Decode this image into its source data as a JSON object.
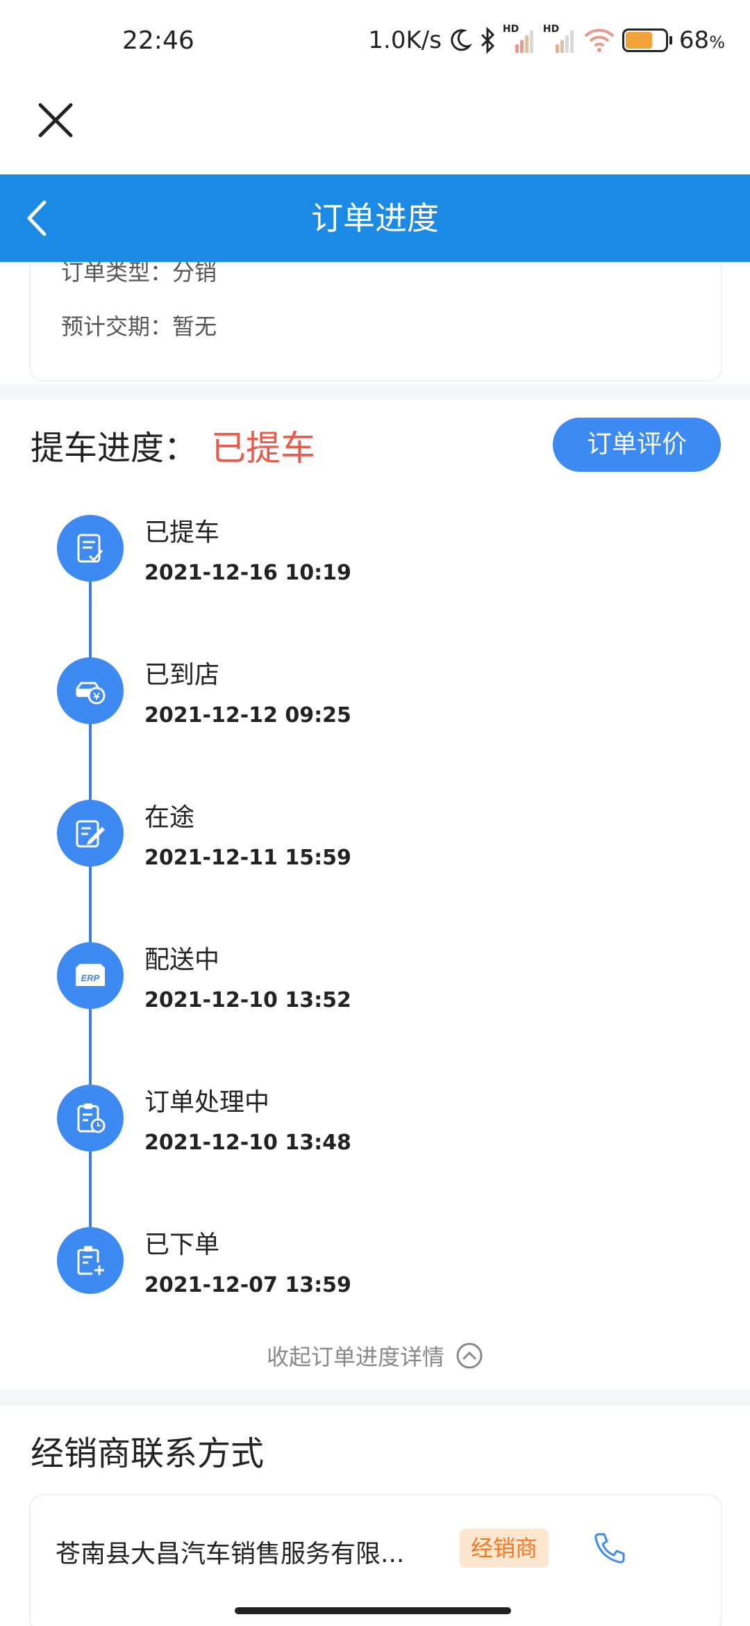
{
  "status_bar": {
    "time": "22:46",
    "net_speed": "1.0K/s",
    "battery_percent": "68",
    "battery_level": 0.68,
    "battery_suffix": "%",
    "hd_label": "HD",
    "icons": [
      "moon-icon",
      "bluetooth-icon",
      "signal-icon",
      "signal-icon",
      "wifi-icon",
      "battery-icon"
    ]
  },
  "header": {
    "title": "订单进度",
    "color": "#1a8ae5"
  },
  "order_info": {
    "type_line": "订单类型：分销",
    "delivery_line": "预计交期：暂无"
  },
  "progress": {
    "label": "提车进度：",
    "status": "已提车",
    "status_color": "#ea5a4a",
    "review_button": "订单评价",
    "steps": [
      {
        "title": "已提车",
        "time": "2021-12-16 10:19",
        "icon": "checklist-icon"
      },
      {
        "title": "已到店",
        "time": "2021-12-12 09:25",
        "icon": "car-receive-icon"
      },
      {
        "title": "在途",
        "time": "2021-12-11 15:59",
        "icon": "edit-document-icon"
      },
      {
        "title": "配送中",
        "time": "2021-12-10 13:52",
        "icon": "erp-box-icon"
      },
      {
        "title": "订单处理中",
        "time": "2021-12-10 13:48",
        "icon": "clipboard-clock-icon"
      },
      {
        "title": "已下单",
        "time": "2021-12-07 13:59",
        "icon": "clipboard-add-icon"
      }
    ],
    "collapse_label": "收起订单进度详情"
  },
  "dealer": {
    "section_title": "经销商联系方式",
    "name": "苍南县大昌汽车销售服务有限...",
    "badge": "经销商"
  },
  "colors": {
    "accent_blue": "#3d8af2",
    "badge_orange": "#f07a22"
  }
}
